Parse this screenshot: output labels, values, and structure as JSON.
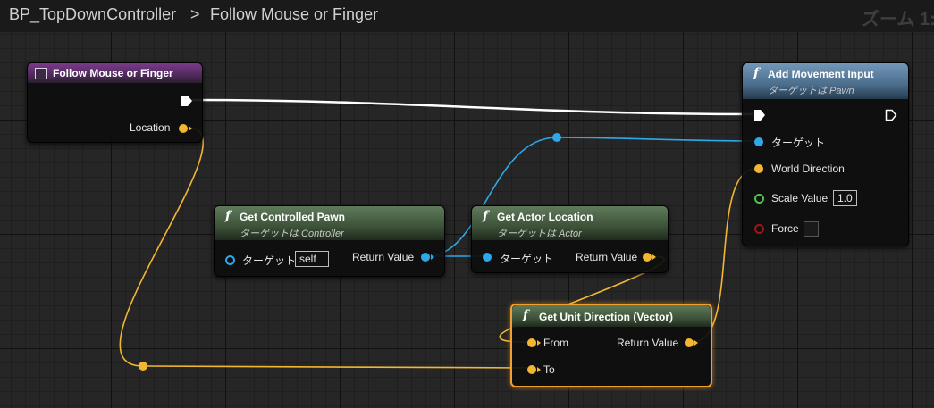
{
  "breadcrumb": {
    "blueprint": "BP_TopDownController",
    "separator": ">",
    "graph": "Follow Mouse or Finger"
  },
  "zoom_label": "ズーム 1:",
  "nodes": {
    "event": {
      "title": "Follow Mouse or Finger",
      "location_label": "Location",
      "icon": "event-graph-icon"
    },
    "add_movement": {
      "title": "Add Movement Input",
      "subtitle": "ターゲットは Pawn",
      "target_label": "ターゲット",
      "world_direction_label": "World Direction",
      "scale_label": "Scale Value",
      "scale_value": "1.0",
      "force_label": "Force",
      "icon": "function-icon"
    },
    "get_pawn": {
      "title": "Get Controlled Pawn",
      "subtitle": "ターゲットは Controller",
      "target_label": "ターゲット",
      "target_value": "self",
      "return_label": "Return Value",
      "icon": "function-icon"
    },
    "get_actor": {
      "title": "Get Actor Location",
      "subtitle": "ターゲットは Actor",
      "target_label": "ターゲット",
      "return_label": "Return Value",
      "icon": "function-icon"
    },
    "unit_dir": {
      "title": "Get Unit Direction (Vector)",
      "from_label": "From",
      "to_label": "To",
      "return_label": "Return Value",
      "icon": "function-icon"
    }
  },
  "colors": {
    "exec": "#ffffff",
    "vector": "#f2b632",
    "object": "#2ea8e8",
    "float": "#4fc34a",
    "bool": "#a01616",
    "selected": "#f0a030"
  },
  "fn_glyph": "f"
}
